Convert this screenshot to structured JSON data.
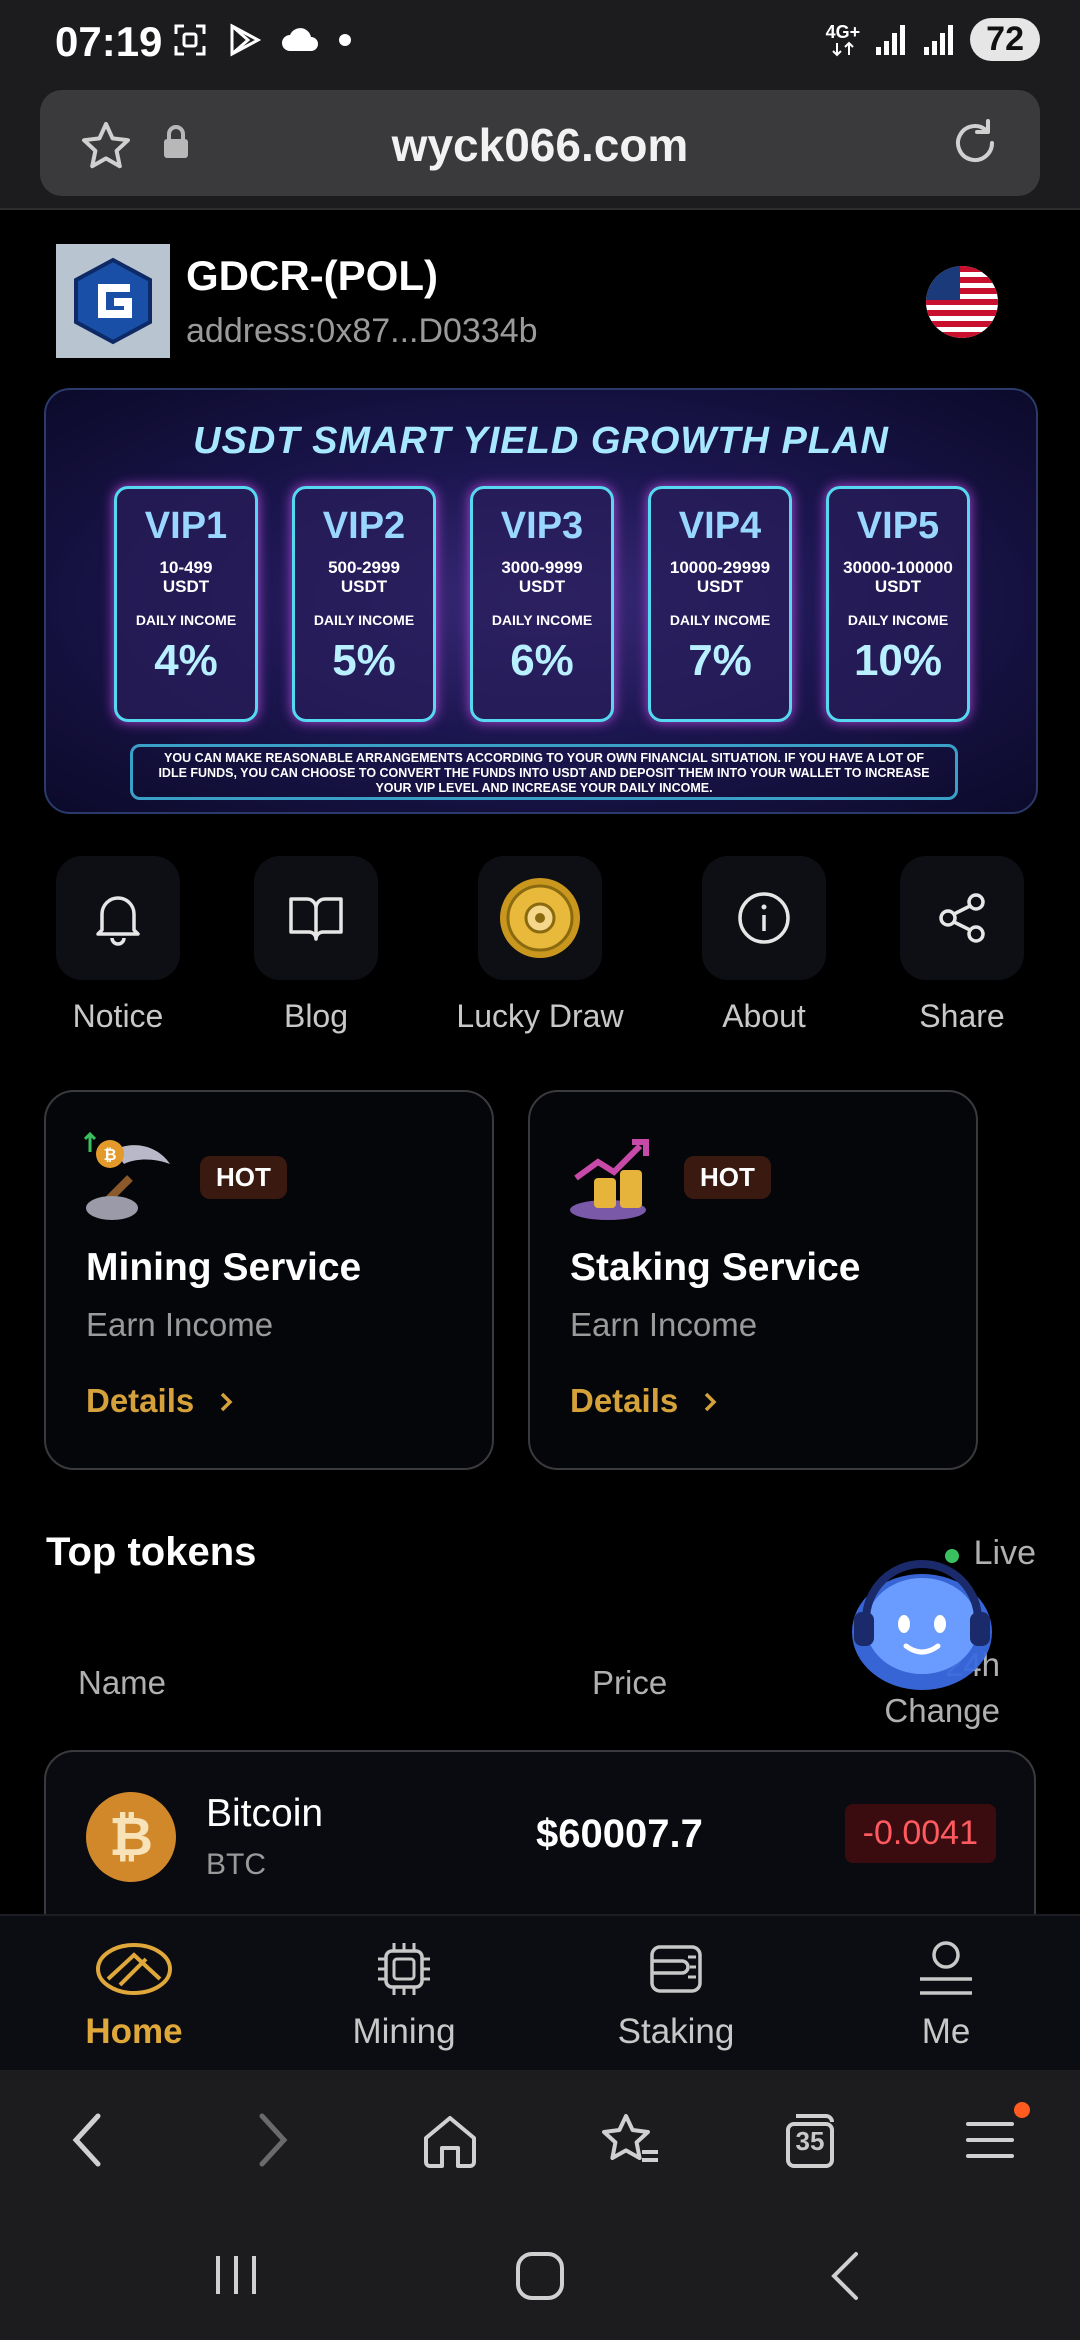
{
  "status_bar": {
    "time": "07:19",
    "network": "4G+",
    "battery": "72"
  },
  "browser": {
    "url": "wyck066.com",
    "tabs_count": "35"
  },
  "header": {
    "title": "GDCR-(POL)",
    "address": "address:0x87...D0334b"
  },
  "banner": {
    "title": "USDT SMART YIELD GROWTH PLAN",
    "vips": [
      {
        "name": "VIP1",
        "range": "10-499",
        "unit": "USDT",
        "label": "DAILY INCOME",
        "rate": "4%"
      },
      {
        "name": "VIP2",
        "range": "500-2999",
        "unit": "USDT",
        "label": "DAILY INCOME",
        "rate": "5%"
      },
      {
        "name": "VIP3",
        "range": "3000-9999",
        "unit": "USDT",
        "label": "DAILY INCOME",
        "rate": "6%"
      },
      {
        "name": "VIP4",
        "range": "10000-29999",
        "unit": "USDT",
        "label": "DAILY INCOME",
        "rate": "7%"
      },
      {
        "name": "VIP5",
        "range": "30000-100000",
        "unit": "USDT",
        "label": "DAILY INCOME",
        "rate": "10%"
      }
    ],
    "note": "YOU CAN MAKE REASONABLE ARRANGEMENTS ACCORDING TO YOUR OWN FINANCIAL SITUATION. IF YOU HAVE A LOT OF IDLE FUNDS, YOU CAN CHOOSE TO CONVERT THE FUNDS INTO USDT AND DEPOSIT THEM INTO YOUR WALLET TO INCREASE YOUR VIP LEVEL AND INCREASE YOUR DAILY INCOME."
  },
  "actions": [
    {
      "label": "Notice",
      "icon": "bell-icon"
    },
    {
      "label": "Blog",
      "icon": "book-icon"
    },
    {
      "label": "Lucky Draw",
      "icon": "wheel-icon"
    },
    {
      "label": "About",
      "icon": "info-icon"
    },
    {
      "label": "Share",
      "icon": "share-icon"
    }
  ],
  "services": [
    {
      "badge": "HOT",
      "title": "Mining Service",
      "subtitle": "Earn Income",
      "link": "Details"
    },
    {
      "badge": "HOT",
      "title": "Staking Service",
      "subtitle": "Earn Income",
      "link": "Details"
    }
  ],
  "tokens": {
    "title": "Top tokens",
    "live": "Live",
    "columns": {
      "name": "Name",
      "price": "Price",
      "change_line1": "24h",
      "change_line2": "Change"
    },
    "rows": [
      {
        "name": "Bitcoin",
        "symbol": "BTC",
        "price": "$60007.7",
        "change": "-0.0041"
      }
    ]
  },
  "tabnav": [
    {
      "label": "Home",
      "icon": "home-icon",
      "active": true
    },
    {
      "label": "Mining",
      "icon": "chip-icon",
      "active": false
    },
    {
      "label": "Staking",
      "icon": "wallet-icon",
      "active": false
    },
    {
      "label": "Me",
      "icon": "user-icon",
      "active": false
    }
  ],
  "colors": {
    "accent": "#e0a83a",
    "negative": "#ff5a5f",
    "background": "#000000"
  }
}
